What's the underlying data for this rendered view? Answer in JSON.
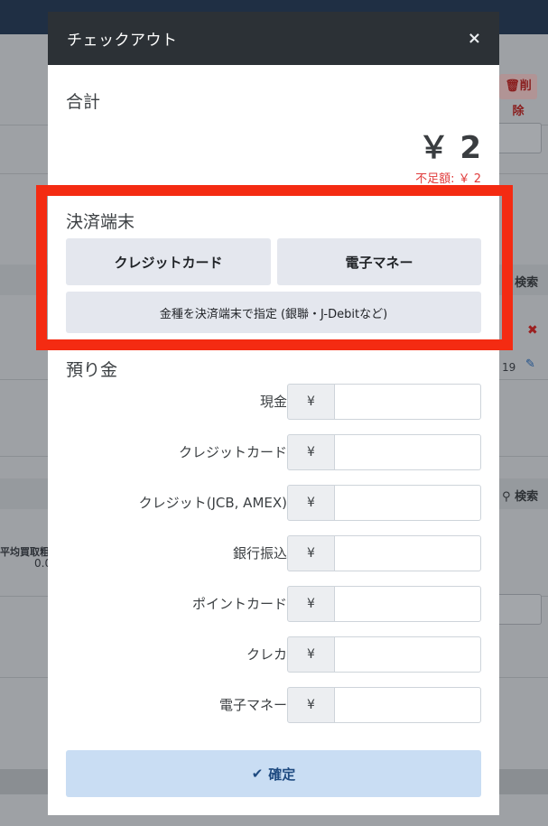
{
  "background": {
    "delete_label": "削除",
    "search_label_1": "検索",
    "search_label_2": "検索",
    "number_value": "19",
    "left_label": "平均買取粗利",
    "left_value": "0.0"
  },
  "modal": {
    "title": "チェックアウト",
    "close_symbol": "×",
    "total_label": "合計",
    "total_amount": "￥ 2",
    "shortage_text": "不足額: ￥ 2",
    "terminal_label": "決済端末",
    "terminal_buttons": {
      "credit_card": "クレジットカード",
      "e_money": "電子マネー",
      "specify_on_terminal": "金種を決済端末で指定 (銀聯・J-Debitなど)"
    },
    "deposit_label": "預り金",
    "currency_symbol": "¥",
    "payment_methods": [
      {
        "label": "現金",
        "value": ""
      },
      {
        "label": "クレジットカード",
        "value": ""
      },
      {
        "label": "クレジット(JCB, AMEX)",
        "value": ""
      },
      {
        "label": "銀行振込",
        "value": ""
      },
      {
        "label": "ポイントカード",
        "value": ""
      },
      {
        "label": "クレカ",
        "value": ""
      },
      {
        "label": "電子マネー",
        "value": ""
      }
    ],
    "confirm_label": "確定"
  },
  "colors": {
    "highlight": "#f42b12",
    "header_bg": "#2c3136",
    "shortage_text": "#e03b3b",
    "confirm_bg": "#c9ddf3"
  }
}
